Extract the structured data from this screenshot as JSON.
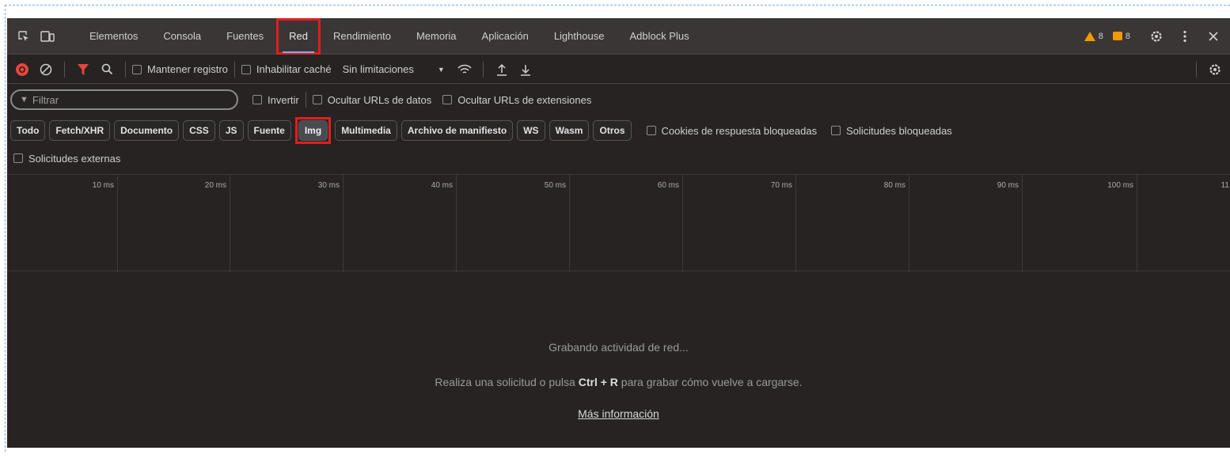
{
  "tabs": [
    "Elementos",
    "Consola",
    "Fuentes",
    "Red",
    "Rendimiento",
    "Memoria",
    "Aplicación",
    "Lighthouse",
    "Adblock Plus"
  ],
  "active_tab_index": 3,
  "status": {
    "warnings": "8",
    "errors": "8"
  },
  "toolbar": {
    "preserve_log": "Mantener registro",
    "disable_cache": "Inhabilitar caché",
    "throttling": "Sin limitaciones"
  },
  "filter": {
    "placeholder": "Filtrar",
    "invert": "Invertir",
    "hide_data_urls": "Ocultar URLs de datos",
    "hide_extension_urls": "Ocultar URLs de extensiones"
  },
  "types": [
    "Todo",
    "Fetch/XHR",
    "Documento",
    "CSS",
    "JS",
    "Fuente",
    "Img",
    "Multimedia",
    "Archivo de manifiesto",
    "WS",
    "Wasm",
    "Otros"
  ],
  "active_type_index": 6,
  "blocked_cookies": "Cookies de respuesta bloqueadas",
  "blocked_requests": "Solicitudes bloqueadas",
  "external_requests": "Solicitudes externas",
  "timeline_ticks": [
    "10 ms",
    "20 ms",
    "30 ms",
    "40 ms",
    "50 ms",
    "60 ms",
    "70 ms",
    "80 ms",
    "90 ms",
    "100 ms",
    "11"
  ],
  "empty": {
    "recording": "Grabando actividad de red...",
    "hint_before": "Realiza una solicitud o pulsa ",
    "hint_key": "Ctrl + R",
    "hint_after": " para grabar cómo vuelve a cargarse.",
    "more_info": "Más información"
  },
  "colors": {
    "record": "#e8453c",
    "filter_funnel": "#e8453c",
    "warning": "#f29900",
    "error": "#e8453c",
    "highlight": "#e01e1e"
  }
}
